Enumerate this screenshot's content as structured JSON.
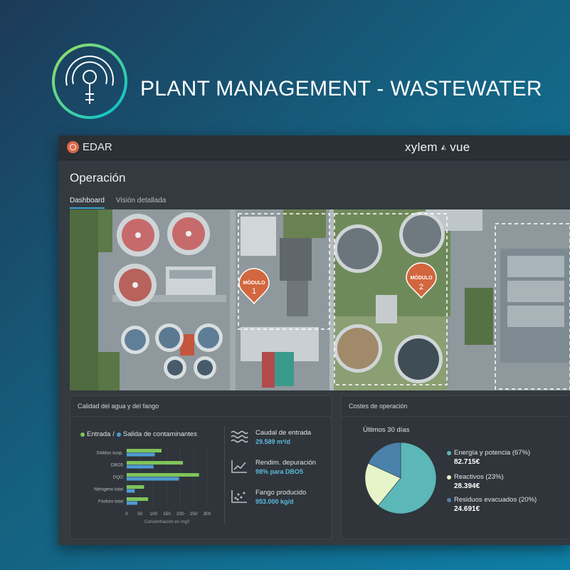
{
  "hero": {
    "title": "PLANT MANAGEMENT - WASTEWATER",
    "logo_icon": "water-drop-gauge-icon"
  },
  "appbar": {
    "app_name": "EDAR",
    "vendor_logo_left": "xylem",
    "vendor_logo_right": "vue"
  },
  "page": {
    "title": "Operación"
  },
  "tabs": [
    {
      "label": "Dashboard",
      "active": true
    },
    {
      "label": "Visión detallada",
      "active": false
    }
  ],
  "map": {
    "markers": [
      {
        "line1": "MÓDULO",
        "line2": "1"
      },
      {
        "line1": "MÓDULO",
        "line2": "2"
      }
    ]
  },
  "quality": {
    "title": "Calidad del agua y del fango",
    "legend": {
      "in": "Entrada",
      "sep": "/",
      "out": "Salida de contaminantes"
    },
    "stats": [
      {
        "label": "Caudal de entrada",
        "value": "29.589 m³/d",
        "icon": "waves-icon"
      },
      {
        "label": "Rendim. depuración",
        "value": "98% para DBO5",
        "icon": "trend-up-chart-icon"
      },
      {
        "label": "Fango producido",
        "value": "953.000 kg/d",
        "icon": "scatter-dots-icon"
      }
    ]
  },
  "costs": {
    "title": "Costes de operación",
    "period": "Últimos 30 días",
    "items": [
      {
        "label": "Energía y potencia (67%)",
        "value": "82.715€"
      },
      {
        "label": "Reactivos (23%)",
        "value": "28.394€"
      },
      {
        "label": "Residuos evacuados (20%)",
        "value": "24.691€"
      }
    ]
  },
  "colors": {
    "accent": "#3aa6d0",
    "entrada": "#7fc45a",
    "salida": "#4f9ad1",
    "pie_energy": "#5bb7b8",
    "pie_reactivos": "#e6f5c8",
    "pie_residuos": "#4b82ab",
    "marker": "#d2673f"
  },
  "chart_data": [
    {
      "type": "bar",
      "orientation": "horizontal",
      "categories": [
        "Sólidos susp.",
        "DBO5",
        "DQO",
        "Nitrógeno total",
        "Fósforo total"
      ],
      "series": [
        {
          "name": "Entrada",
          "values": [
            130,
            210,
            270,
            65,
            80
          ]
        },
        {
          "name": "Salida de contaminantes",
          "values": [
            105,
            100,
            195,
            30,
            40
          ]
        }
      ],
      "xlabel": "Concentración en mg/l",
      "xticks": [
        0,
        50,
        100,
        150,
        200,
        250,
        300
      ],
      "xlim": [
        0,
        300
      ]
    },
    {
      "type": "pie",
      "labels": [
        "Energía y potencia",
        "Reactivos",
        "Residuos evacuados"
      ],
      "values": [
        67,
        23,
        20
      ]
    }
  ]
}
